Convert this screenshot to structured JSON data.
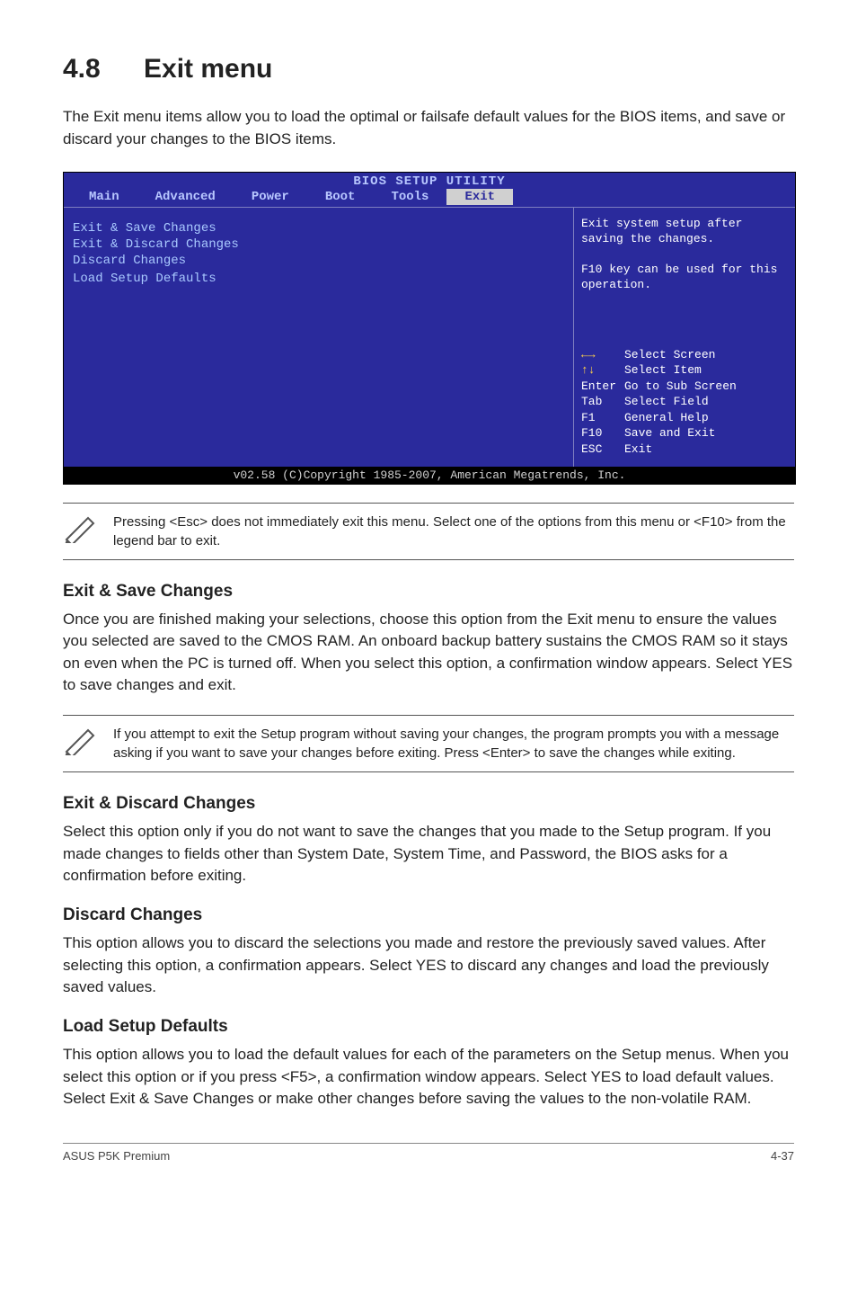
{
  "heading": {
    "num": "4.8",
    "title": "Exit menu"
  },
  "intro": "The Exit menu items allow you to load the optimal or failsafe default values for the BIOS items, and save or discard your changes to the BIOS items.",
  "bios": {
    "title": "BIOS SETUP UTILITY",
    "tabs": [
      "Main",
      "Advanced",
      "Power",
      "Boot",
      "Tools",
      "Exit"
    ],
    "active_tab": "Exit",
    "left_items": [
      "Exit & Save Changes",
      "Exit & Discard Changes",
      "Discard Changes",
      "",
      "Load Setup Defaults"
    ],
    "help_top": "Exit system setup after saving the changes.\n\nF10 key can be used for this operation.",
    "keys": [
      {
        "key": "←→",
        "label": "Select Screen",
        "arrow": true
      },
      {
        "key": "↑↓",
        "label": "Select Item",
        "arrow": true
      },
      {
        "key": "Enter",
        "label": "Go to Sub Screen"
      },
      {
        "key": "Tab",
        "label": "Select Field"
      },
      {
        "key": "F1",
        "label": "General Help"
      },
      {
        "key": "F10",
        "label": "Save and Exit"
      },
      {
        "key": "ESC",
        "label": "Exit"
      }
    ],
    "footer": "v02.58 (C)Copyright 1985-2007, American Megatrends, Inc."
  },
  "note1": "Pressing <Esc> does not immediately exit this menu. Select one of the options from this menu or <F10> from the legend bar to exit.",
  "sections": [
    {
      "title": "Exit & Save Changes",
      "body": "Once you are finished making your selections, choose this option from the Exit menu to ensure the values you selected are saved to the CMOS RAM. An onboard backup battery sustains the CMOS RAM so it stays on even when the PC is turned off. When you select this option, a confirmation window appears. Select YES to save changes and exit."
    }
  ],
  "note2": "If you attempt to exit the Setup program without saving your changes, the program prompts you with a message asking if you want to save your changes before exiting. Press <Enter> to save the changes while exiting.",
  "sections2": [
    {
      "title": "Exit & Discard Changes",
      "body": "Select this option only if you do not want to save the changes that you  made to the Setup program. If you made changes to fields other than System Date, System Time, and Password, the BIOS asks for a confirmation before exiting."
    },
    {
      "title": "Discard Changes",
      "body": "This option allows you to discard the selections you made and restore the previously saved values. After selecting this option, a confirmation appears. Select YES to discard any changes and load the previously saved values."
    },
    {
      "title": "Load Setup Defaults",
      "body": "This option allows you to load the default values for each of the parameters on the Setup menus. When you select this option or if you press <F5>, a confirmation window appears. Select YES to load default values. Select Exit & Save Changes or make other changes before saving the values to the non-volatile RAM."
    }
  ],
  "footer": {
    "left": "ASUS P5K Premium",
    "right": "4-37"
  }
}
